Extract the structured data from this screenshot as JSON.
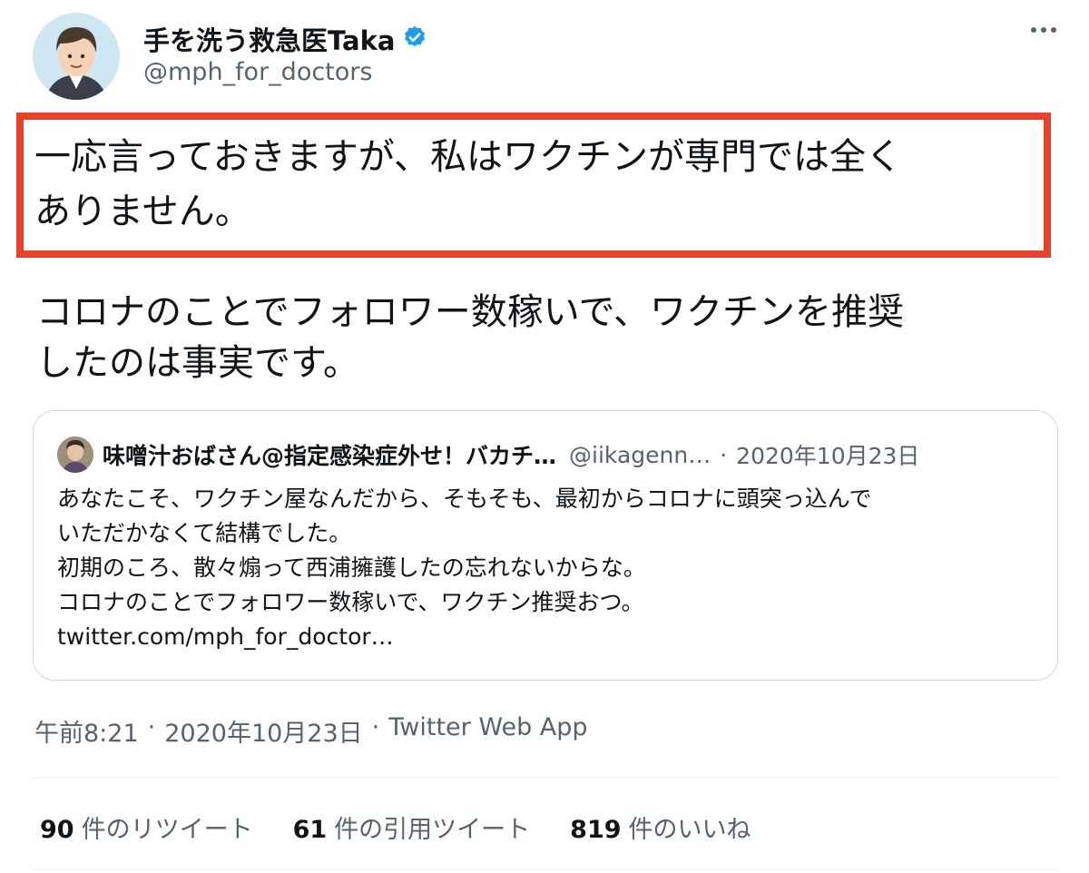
{
  "author": {
    "display_name": "手を洗う救急医Taka",
    "handle": "@mph_for_doctors",
    "verified_icon": "verified-badge-icon",
    "verified_color": "#1d9bf0"
  },
  "tweet": {
    "highlight_line1": "一応言っておきますが、私はワクチンが専門では全く",
    "highlight_line2": "ありません。",
    "body_line1": "コロナのことでフォロワー数稼いで、ワクチンを推奨",
    "body_line2": "したのは事実です。",
    "highlight_color": "#e8412c"
  },
  "quote": {
    "display_name": "味噌汁おばさん@指定感染症外せ！バカチ…",
    "handle": "@iikagenn…",
    "separator": "·",
    "date": "2020年10月23日",
    "lines": [
      "あなたこそ、ワクチン屋なんだから、そもそも、最初からコロナに頭突っ込んで",
      "いただかなくて結構でした。",
      "初期のころ、散々煽って西浦擁護したの忘れないからな。",
      "コロナのことでフォロワー数稼いで、ワクチン推奨おつ。",
      "twitter.com/mph_for_doctor…"
    ]
  },
  "meta": {
    "time": "午前8:21",
    "separator": "·",
    "date": "2020年10月23日",
    "source": "Twitter Web App"
  },
  "stats": {
    "retweets_count": "90",
    "retweets_label": "件のリツイート",
    "quotes_count": "61",
    "quotes_label": "件の引用ツイート",
    "likes_count": "819",
    "likes_label": "件のいいね"
  }
}
